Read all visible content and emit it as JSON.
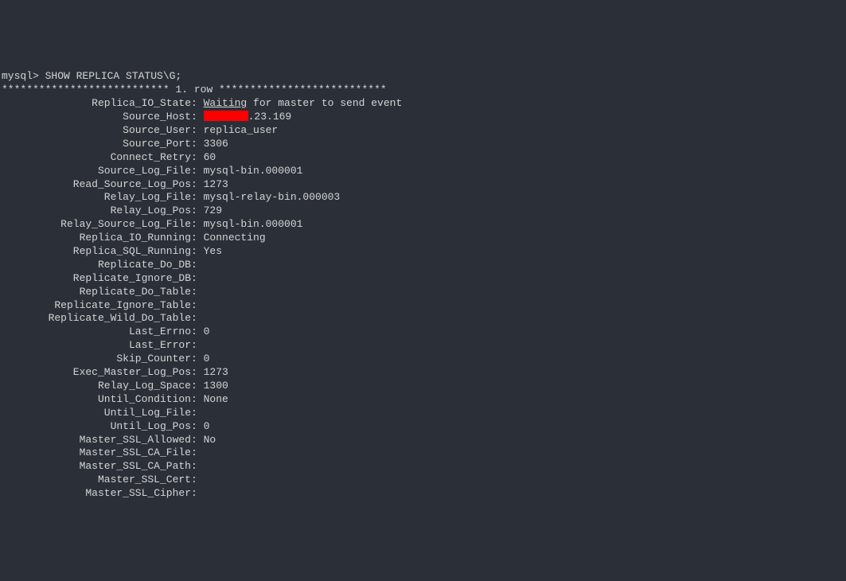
{
  "prompt": "mysql> SHOW REPLICA STATUS\\G;",
  "separator": "*************************** 1. row ***************************",
  "host_suffix": ".23.169",
  "fields": [
    {
      "label": "Replica_IO_State",
      "value": "Waiting for master to send event",
      "underline_first": true
    },
    {
      "label": "Source_Host",
      "value": "__REDACTED__",
      "redacted": true
    },
    {
      "label": "Source_User",
      "value": "replica_user"
    },
    {
      "label": "Source_Port",
      "value": "3306"
    },
    {
      "label": "Connect_Retry",
      "value": "60"
    },
    {
      "label": "Source_Log_File",
      "value": "mysql-bin.000001"
    },
    {
      "label": "Read_Source_Log_Pos",
      "value": "1273"
    },
    {
      "label": "Relay_Log_File",
      "value": "mysql-relay-bin.000003"
    },
    {
      "label": "Relay_Log_Pos",
      "value": "729"
    },
    {
      "label": "Relay_Source_Log_File",
      "value": "mysql-bin.000001"
    },
    {
      "label": "Replica_IO_Running",
      "value": "Connecting"
    },
    {
      "label": "Replica_SQL_Running",
      "value": "Yes"
    },
    {
      "label": "Replicate_Do_DB",
      "value": ""
    },
    {
      "label": "Replicate_Ignore_DB",
      "value": ""
    },
    {
      "label": "Replicate_Do_Table",
      "value": ""
    },
    {
      "label": "Replicate_Ignore_Table",
      "value": ""
    },
    {
      "label": "Replicate_Wild_Do_Table",
      "value": ""
    },
    {
      "label": "Last_Errno",
      "value": "0"
    },
    {
      "label": "Last_Error",
      "value": ""
    },
    {
      "label": "Skip_Counter",
      "value": "0"
    },
    {
      "label": "Exec_Master_Log_Pos",
      "value": "1273"
    },
    {
      "label": "Relay_Log_Space",
      "value": "1300"
    },
    {
      "label": "Until_Condition",
      "value": "None"
    },
    {
      "label": "Until_Log_File",
      "value": ""
    },
    {
      "label": "Until_Log_Pos",
      "value": "0"
    },
    {
      "label": "Master_SSL_Allowed",
      "value": "No"
    },
    {
      "label": "Master_SSL_CA_File",
      "value": ""
    },
    {
      "label": "Master_SSL_CA_Path",
      "value": ""
    },
    {
      "label": "Master_SSL_Cert",
      "value": ""
    },
    {
      "label": "Master_SSL_Cipher",
      "value": ""
    }
  ]
}
